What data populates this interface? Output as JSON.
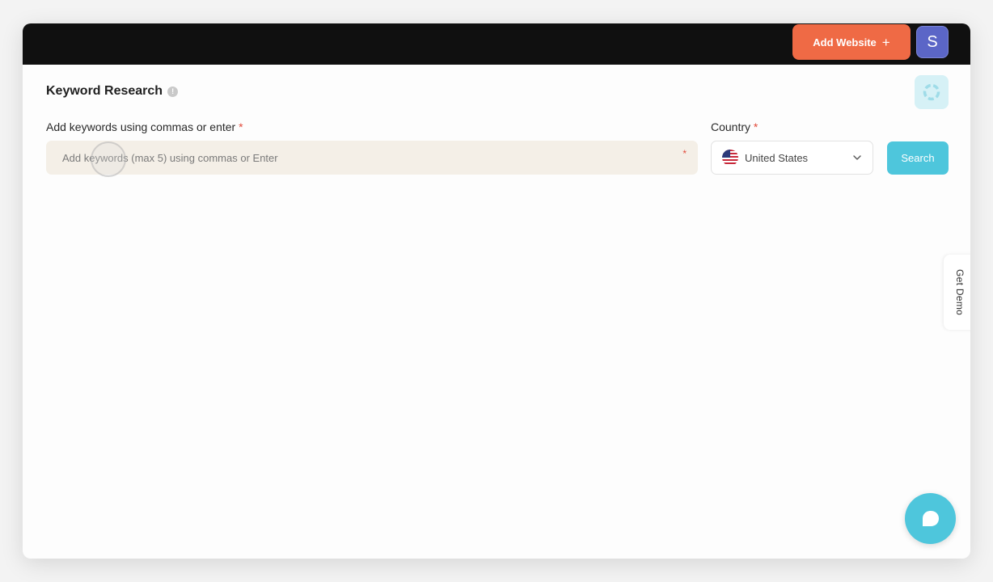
{
  "header": {
    "add_website_label": "Add Website",
    "add_icon": "plus-icon",
    "avatar_initial": "S"
  },
  "page": {
    "title": "Keyword Research",
    "info_icon": "info-icon",
    "loader_icon": "spinner-icon"
  },
  "form": {
    "keywords_label": "Add keywords using commas or enter",
    "keywords_required": "*",
    "keywords_placeholder": "Add keywords (max 5) using commas or Enter",
    "keywords_value": "",
    "country_label": "Country",
    "country_required": "*",
    "country_value": "United States",
    "country_flag_icon": "us-flag-icon",
    "search_label": "Search"
  },
  "side_tab": {
    "label": "Get Demo"
  },
  "chat": {
    "icon": "chat-bubble-icon"
  },
  "colors": {
    "accent_orange": "#ef6a45",
    "accent_teal": "#4ec6dc",
    "avatar": "#5b66c7",
    "input_bg": "#f4efe7"
  }
}
